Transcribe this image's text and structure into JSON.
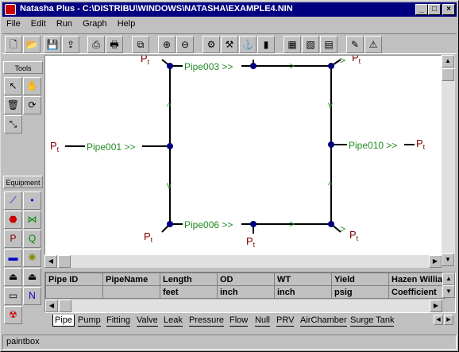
{
  "window": {
    "title": "Natasha Plus - C:\\DISTRIBU\\WINDOWS\\NATASHA\\EXAMPLE4.NIN"
  },
  "menu": [
    "File",
    "Edit",
    "Run",
    "Graph",
    "Help"
  ],
  "toolbar_icons": [
    "new-file-icon",
    "open-folder-icon",
    "save-icon",
    "save-as-icon",
    "print-setup-icon",
    "print-icon",
    "copy-icon",
    "zoom-in-icon",
    "zoom-out-icon",
    "run-icon",
    "graph-icon",
    "network-icon",
    "bar-chart-icon",
    "chart1-icon",
    "chart2-icon",
    "chart3-icon",
    "edit-icon",
    "help-icon"
  ],
  "palette": {
    "tools_label": "Tools",
    "equipment_label": "Equipment"
  },
  "canvas": {
    "pipes": [
      "Pipe003 >>",
      "Pipe001 >>",
      "Pipe006 >>",
      "Pipe010 >>"
    ],
    "pressure_label": "P",
    "pressure_sub": "t"
  },
  "grid": {
    "headers": [
      "Pipe ID",
      "PipeName",
      "Length",
      "OD",
      "WT",
      "Yield",
      "Hazen Willia"
    ],
    "units": [
      "",
      "",
      "feet",
      "inch",
      "inch",
      "psig",
      "Coefficient"
    ]
  },
  "tabs": [
    "Pipe",
    "Pump",
    "Fitting",
    "Valve",
    "Leak",
    "Pressure",
    "Flow",
    "Null",
    "PRV",
    "AirChamber",
    "Surge Tank"
  ],
  "status": {
    "text": "paintbox"
  }
}
